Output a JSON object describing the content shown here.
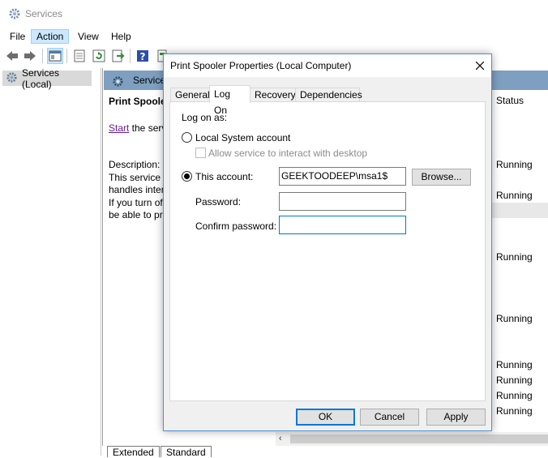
{
  "window": {
    "title": "Services"
  },
  "menu": [
    "File",
    "Action",
    "View",
    "Help"
  ],
  "toolbar_icons": [
    "back-icon",
    "forward-icon",
    "console-tree-icon",
    "properties-icon",
    "refresh-icon",
    "export-icon",
    "help-icon",
    "details-icon",
    "start-icon",
    "stop-icon"
  ],
  "left_pane": {
    "tree_item": "Services (Local)"
  },
  "right_pane": {
    "header": "Service",
    "service_name": "Print Spoole",
    "start_link": "Start",
    "start_rest": " the serv",
    "description_label": "Description:",
    "description_lines": [
      "This service s",
      "handles inter",
      "If you turn of",
      "be able to pr"
    ],
    "status_header": "Status",
    "statuses": [
      "Running",
      "Running",
      "Running",
      "Running",
      "Running",
      "Running",
      "Running",
      "Running"
    ],
    "bottom_tabs": [
      "Extended",
      "Standard"
    ]
  },
  "dialog": {
    "title": "Print Spooler Properties (Local Computer)",
    "tabs": [
      "General",
      "Log On",
      "Recovery",
      "Dependencies"
    ],
    "selected_tab": "Log On",
    "logon_as_label": "Log on as:",
    "local_system_label": "Local System account",
    "local_system_selected": false,
    "allow_interact_label": "Allow service to interact with desktop",
    "allow_interact_checked": false,
    "this_account_label": "This account:",
    "this_account_selected": true,
    "account_value": "GEEKTOODEEP\\msa1$",
    "browse_label": "Browse...",
    "password_label": "Password:",
    "password_value": "",
    "confirm_label": "Confirm password:",
    "confirm_value": "",
    "ok_label": "OK",
    "cancel_label": "Cancel",
    "apply_label": "Apply"
  },
  "colors": {
    "header_blue": "#7e9fc0",
    "focus_blue": "#0078d7",
    "link_purple": "#6a1b9a"
  }
}
